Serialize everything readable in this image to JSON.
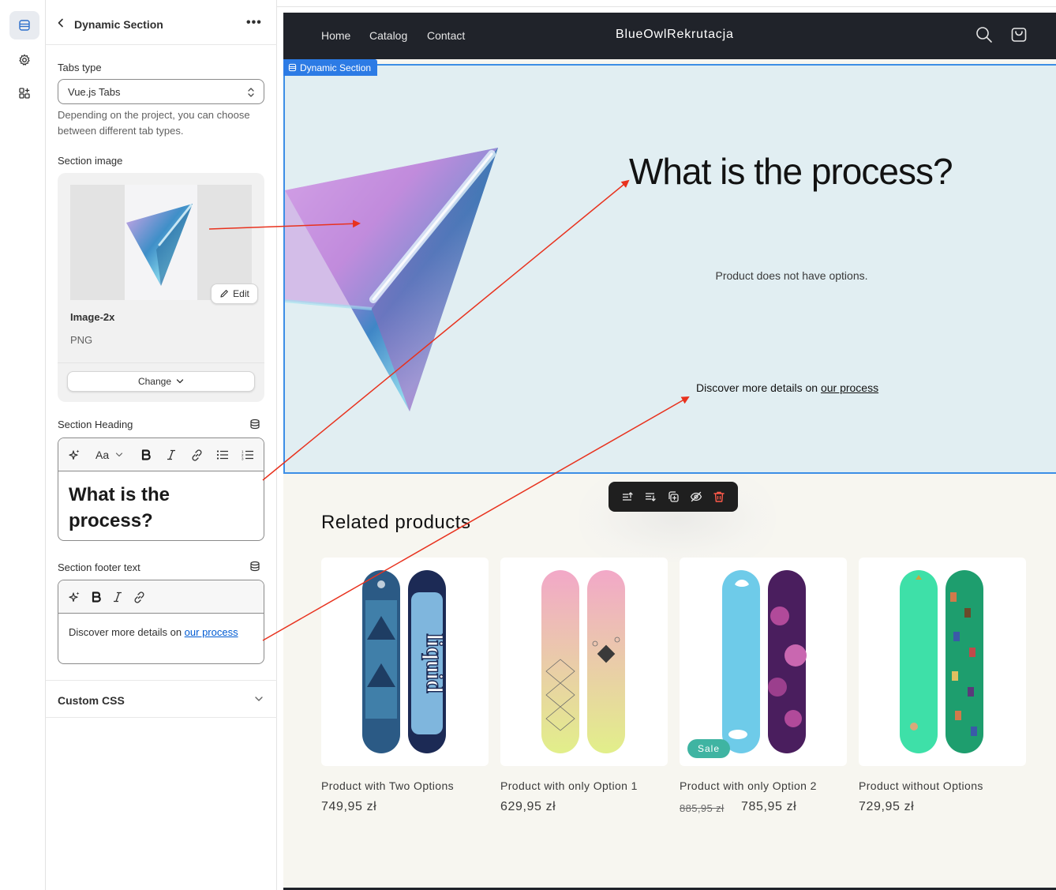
{
  "rail": {
    "items": [
      {
        "icon": "sections-icon",
        "active": true
      },
      {
        "icon": "gear-icon",
        "active": false
      },
      {
        "icon": "apps-icon",
        "active": false
      }
    ]
  },
  "panel": {
    "title": "Dynamic Section",
    "more": "•••",
    "tabs_type": {
      "label": "Tabs type",
      "value": "Vue.js Tabs",
      "help": "Depending on the project, you can choose between different tab types."
    },
    "section_image": {
      "label": "Section image",
      "edit_label": "Edit",
      "file_name": "Image-2x",
      "file_type": "PNG",
      "change_label": "Change"
    },
    "section_heading": {
      "label": "Section Heading",
      "text": "What is the process?",
      "format_label": "Aa"
    },
    "section_footer": {
      "label": "Section footer text",
      "text_before": "Discover more details on ",
      "link_text": "our process"
    },
    "custom_css": {
      "label": "Custom CSS"
    }
  },
  "store": {
    "nav": [
      "Home",
      "Catalog",
      "Contact"
    ],
    "logo": "BlueOwlRekrutacja",
    "section_tag": "Dynamic Section",
    "hero": {
      "title": "What is the process?",
      "subtitle": "Product does not have options.",
      "footer_before": "Discover more details on ",
      "footer_link": "our process"
    },
    "related_title": "Related products",
    "products": [
      {
        "name": "Product with Two Options",
        "price": "749,95 zł",
        "old_price": "",
        "sale": ""
      },
      {
        "name": "Product with only Option 1",
        "price": "629,95 zł",
        "old_price": "",
        "sale": ""
      },
      {
        "name": "Product with only Option 2",
        "price": "785,95 zł",
        "old_price": "885,95 zł",
        "sale": "Sale"
      },
      {
        "name": "Product without Options",
        "price": "729,95 zł",
        "old_price": "",
        "sale": ""
      }
    ]
  },
  "colors": {
    "accent": "#2c7be5",
    "hero_bg": "#e1eef2",
    "header_bg": "#20232a",
    "link": "#005bd3",
    "sale_badge": "#3fb4a2",
    "annotation_arrow": "#e8321e"
  }
}
